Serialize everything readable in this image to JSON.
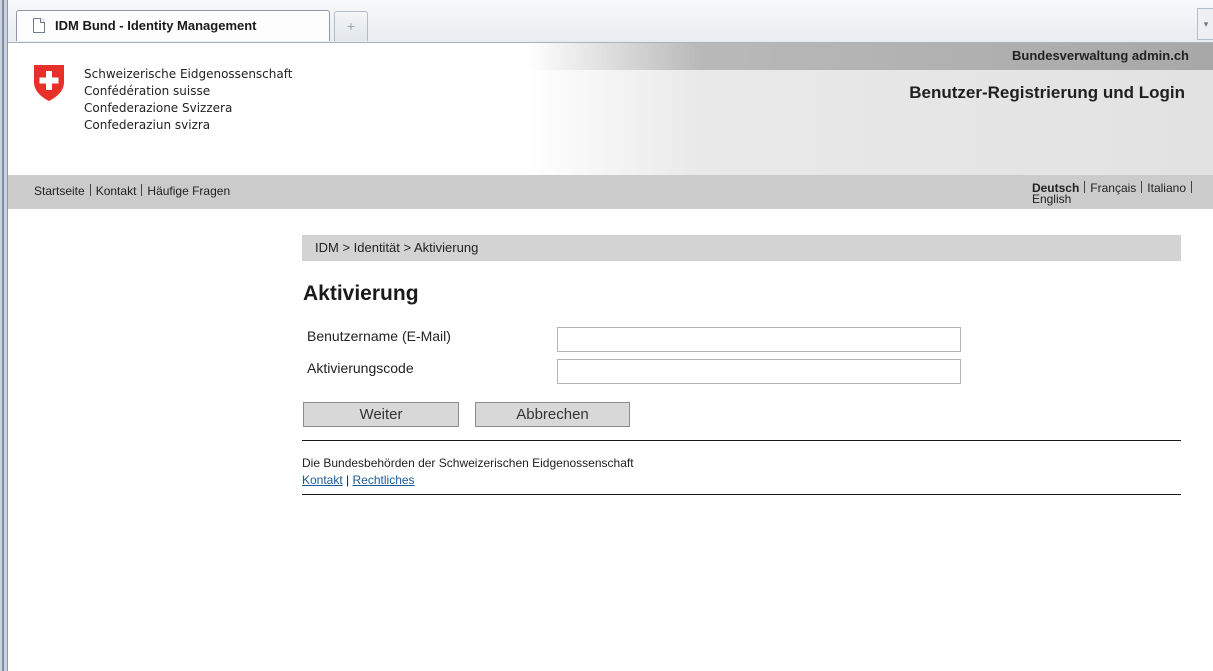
{
  "browser": {
    "tab_title": "IDM Bund - Identity Management",
    "new_tab_glyph": "+",
    "tab_menu_glyph": "▾"
  },
  "header": {
    "admin_link": "Bundesverwaltung admin.ch",
    "site_title": "Benutzer-Registrierung und Login",
    "confederation_lines": [
      "Schweizerische Eidgenossenschaft",
      "Confédération suisse",
      "Confederazione Svizzera",
      "Confederaziun svizra"
    ],
    "crest_color": "#e8302a"
  },
  "nav": {
    "items": [
      "Startseite",
      "Kontakt",
      "Häufige Fragen"
    ],
    "languages": [
      "Deutsch",
      "Français",
      "Italiano",
      "English"
    ]
  },
  "content": {
    "breadcrumb": "IDM > Identität > Aktivierung",
    "page_title": "Aktivierung",
    "form": {
      "username_label": "Benutzername (E-Mail)",
      "username_value": "",
      "code_label": "Aktivierungscode",
      "code_value": "",
      "next_button": "Weiter",
      "cancel_button": "Abbrechen"
    }
  },
  "footer": {
    "text": "Die Bundesbehörden der Schweizerischen Eidgenossenschaft",
    "links": [
      "Kontakt",
      "Rechtliches"
    ],
    "separator": "|"
  }
}
